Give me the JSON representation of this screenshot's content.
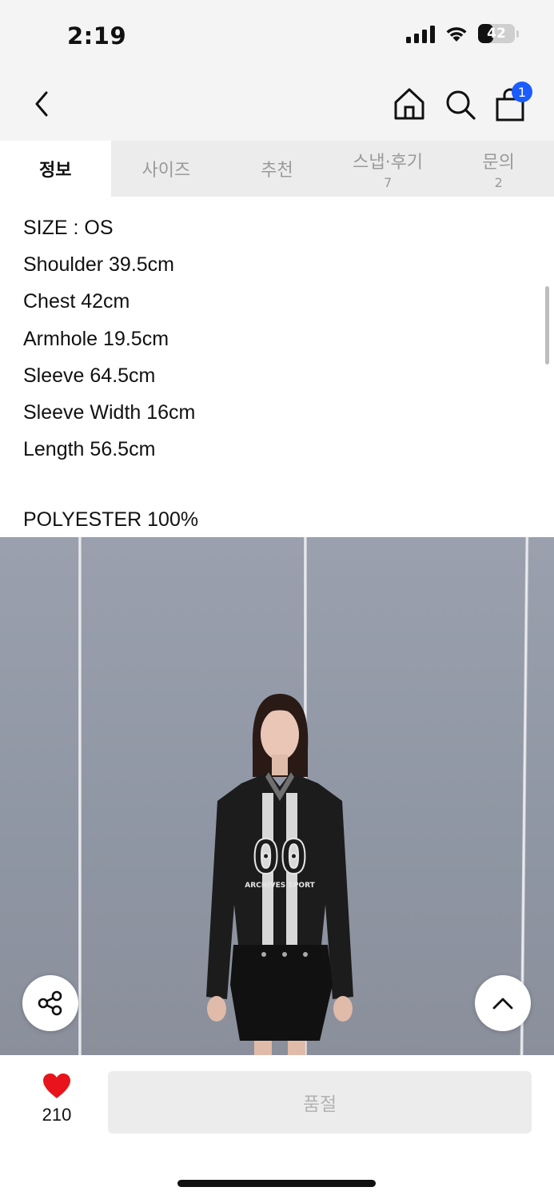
{
  "status": {
    "time": "2:19",
    "battery": "42",
    "battery_level": 0.42
  },
  "nav": {
    "cart_count": "1"
  },
  "tabs": [
    {
      "label": "정보",
      "count": "",
      "active": true
    },
    {
      "label": "사이즈",
      "count": "",
      "active": false
    },
    {
      "label": "추천",
      "count": "",
      "active": false
    },
    {
      "label": "스냅·후기",
      "count": "7",
      "active": false
    },
    {
      "label": "문의",
      "count": "2",
      "active": false
    }
  ],
  "specs": [
    "SIZE : OS",
    "Shoulder 39.5cm",
    "Chest 42cm",
    "Armhole 19.5cm",
    "Sleeve 64.5cm",
    "Sleeve Width 16cm",
    "Length 56.5cm"
  ],
  "material": "POLYESTER 100%",
  "photo": {
    "jersey_number": "00",
    "jersey_text": "ARCHIVES SPORT"
  },
  "bottom": {
    "like_count": "210",
    "buy_label": "품절"
  },
  "colors": {
    "accent_badge": "#1a5cff",
    "heart": "#e8131b"
  }
}
